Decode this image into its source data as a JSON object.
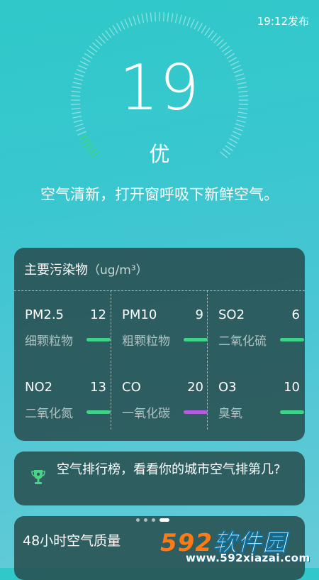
{
  "header": {
    "publish_time": "19:12发布"
  },
  "aqi": {
    "value": "19",
    "level": "优",
    "description": "空气清新，打开窗呼吸下新鲜空气。"
  },
  "pollutants": {
    "title": "主要污染物",
    "unit": "（ug/m³）",
    "items": [
      {
        "name": "PM2.5",
        "value": "12",
        "desc": "细颗粒物",
        "bar_color": "#3fd38a"
      },
      {
        "name": "PM10",
        "value": "9",
        "desc": "粗颗粒物",
        "bar_color": "#3fd38a"
      },
      {
        "name": "SO2",
        "value": "6",
        "desc": "二氧化硫",
        "bar_color": "#3fd38a"
      },
      {
        "name": "NO2",
        "value": "13",
        "desc": "二氧化氮",
        "bar_color": "#3fd38a"
      },
      {
        "name": "CO",
        "value": "20",
        "desc": "一氧化碳",
        "bar_color": "#b45be0"
      },
      {
        "name": "O3",
        "value": "10",
        "desc": "臭氧",
        "bar_color": "#3fd38a"
      }
    ]
  },
  "ranking": {
    "text": "空气排行榜，看看你的城市空气排第几?",
    "icon": "trophy-icon"
  },
  "forecast": {
    "title": "48小时空气质量"
  },
  "watermark": {
    "num": "592",
    "cn": "软件园",
    "url": "www.592xiazai.com"
  },
  "colors": {
    "good": "#3fd38a",
    "co_bar": "#b45be0",
    "card_bg": "#284e50"
  }
}
